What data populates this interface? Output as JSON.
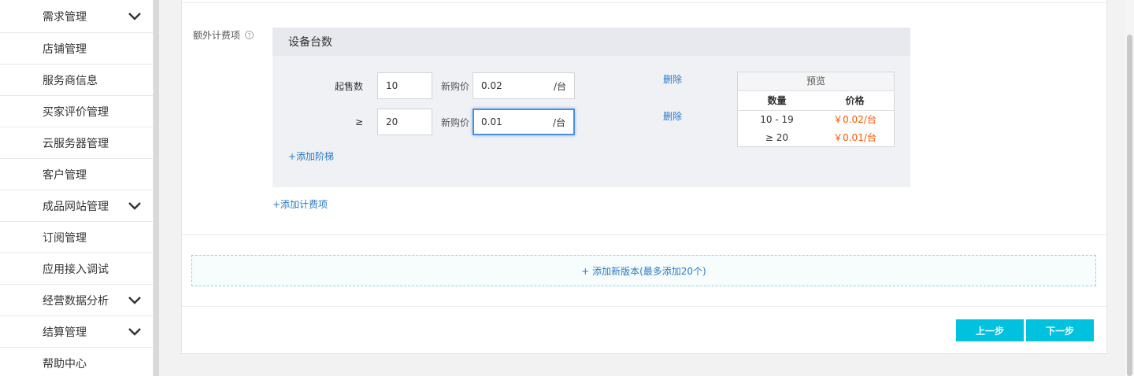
{
  "sidebar": {
    "items": [
      {
        "label": "需求管理",
        "has_children": true
      },
      {
        "label": "店铺管理",
        "has_children": false
      },
      {
        "label": "服务商信息",
        "has_children": false
      },
      {
        "label": "买家评价管理",
        "has_children": false
      },
      {
        "label": "云服务器管理",
        "has_children": false
      },
      {
        "label": "客户管理",
        "has_children": false
      },
      {
        "label": "成品网站管理",
        "has_children": true
      },
      {
        "label": "订阅管理",
        "has_children": false
      },
      {
        "label": "应用接入调试",
        "has_children": false
      },
      {
        "label": "经营数据分析",
        "has_children": true
      },
      {
        "label": "结算管理",
        "has_children": true
      },
      {
        "label": "帮助中心",
        "has_children": false
      }
    ]
  },
  "form": {
    "extra_fee_label": "额外计费项",
    "help_glyph": "?",
    "panel_title": "设备台数",
    "tiers": [
      {
        "prefix": "起售数",
        "quantity": "10",
        "price_label": "新购价",
        "price": "0.02",
        "unit": "/台",
        "delete": "删除"
      },
      {
        "prefix": "≥",
        "quantity": "20",
        "price_label": "新购价",
        "price": "0.01",
        "unit": "/台",
        "delete": "删除"
      }
    ],
    "add_tier": "+添加阶梯",
    "add_fee": "+添加计费项",
    "preview": {
      "title": "预览",
      "col_qty": "数量",
      "col_price": "价格",
      "rows": [
        {
          "qty": "10 - 19",
          "price": "￥0.02/台"
        },
        {
          "qty": "≥ 20",
          "price": "￥0.01/台"
        }
      ]
    },
    "add_version": "+ 添加新版本(最多添加20个)",
    "prev_button": "上一步",
    "next_button": "下一步"
  },
  "colors": {
    "accent": "#00c1de",
    "link": "#2a7ac9",
    "price": "#ff5500"
  }
}
